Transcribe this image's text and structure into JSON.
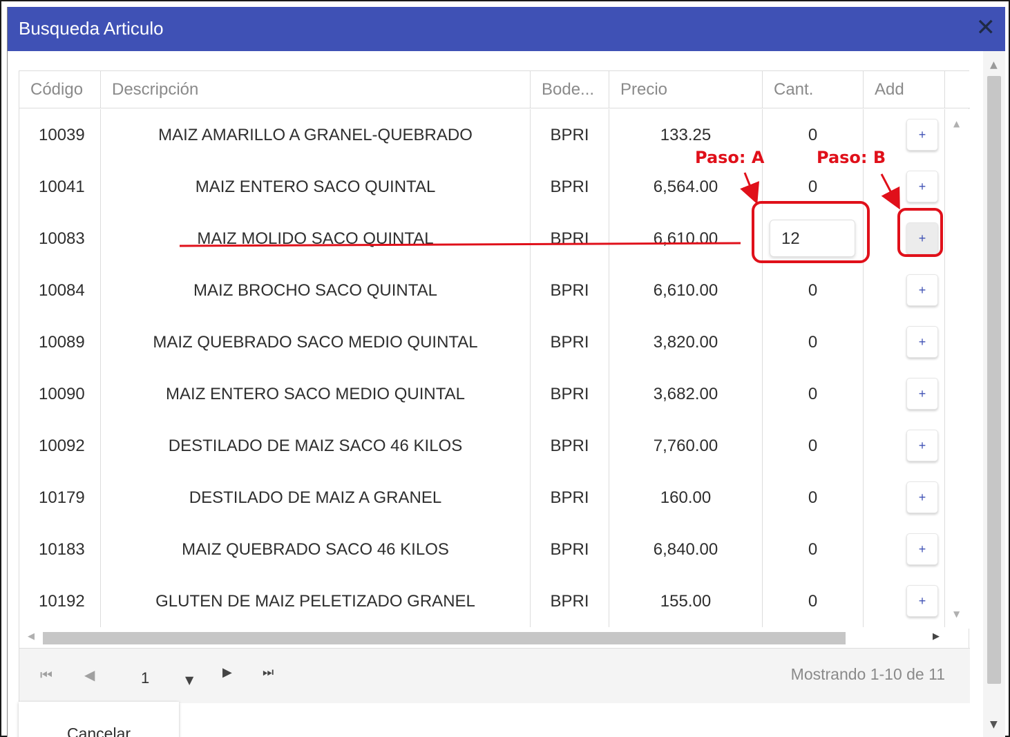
{
  "dialog": {
    "title": "Busqueda Articulo",
    "close_icon": "close-icon",
    "accent_color": "#3f51b5"
  },
  "grid": {
    "columns": [
      "Código",
      "Descripción",
      "Bode...",
      "Precio",
      "Cant.",
      "Add"
    ],
    "add_label": "+",
    "rows": [
      {
        "code": "10039",
        "desc": "MAIZ AMARILLO A GRANEL-QUEBRADO",
        "bodega": "BPRI",
        "price": "133.25",
        "qty": "0"
      },
      {
        "code": "10041",
        "desc": "MAIZ ENTERO SACO QUINTAL",
        "bodega": "BPRI",
        "price": "6,564.00",
        "qty": "0"
      },
      {
        "code": "10083",
        "desc": "MAIZ MOLIDO SACO QUINTAL",
        "bodega": "BPRI",
        "price": "6,610.00",
        "qty": "12"
      },
      {
        "code": "10084",
        "desc": "MAIZ BROCHO SACO QUINTAL",
        "bodega": "BPRI",
        "price": "6,610.00",
        "qty": "0"
      },
      {
        "code": "10089",
        "desc": "MAIZ QUEBRADO SACO MEDIO QUINTAL",
        "bodega": "BPRI",
        "price": "3,820.00",
        "qty": "0"
      },
      {
        "code": "10090",
        "desc": "MAIZ ENTERO SACO MEDIO QUINTAL",
        "bodega": "BPRI",
        "price": "3,682.00",
        "qty": "0"
      },
      {
        "code": "10092",
        "desc": "DESTILADO DE MAIZ SACO 46 KILOS",
        "bodega": "BPRI",
        "price": "7,760.00",
        "qty": "0"
      },
      {
        "code": "10179",
        "desc": "DESTILADO DE MAIZ A GRANEL",
        "bodega": "BPRI",
        "price": "160.00",
        "qty": "0"
      },
      {
        "code": "10183",
        "desc": "MAIZ QUEBRADO SACO 46 KILOS",
        "bodega": "BPRI",
        "price": "6,840.00",
        "qty": "0"
      },
      {
        "code": "10192",
        "desc": "GLUTEN DE MAIZ PELETIZADO GRANEL",
        "bodega": "BPRI",
        "price": "155.00",
        "qty": "0"
      }
    ],
    "editing_row": 2,
    "active_add_row": 2
  },
  "pager": {
    "page": "1",
    "status": "Mostrando 1-10 de 11"
  },
  "footer": {
    "cancel_label": "Cancelar"
  },
  "annotations": {
    "step_a": "Paso: A",
    "step_b": "Paso: B",
    "color": "#e0101a"
  }
}
